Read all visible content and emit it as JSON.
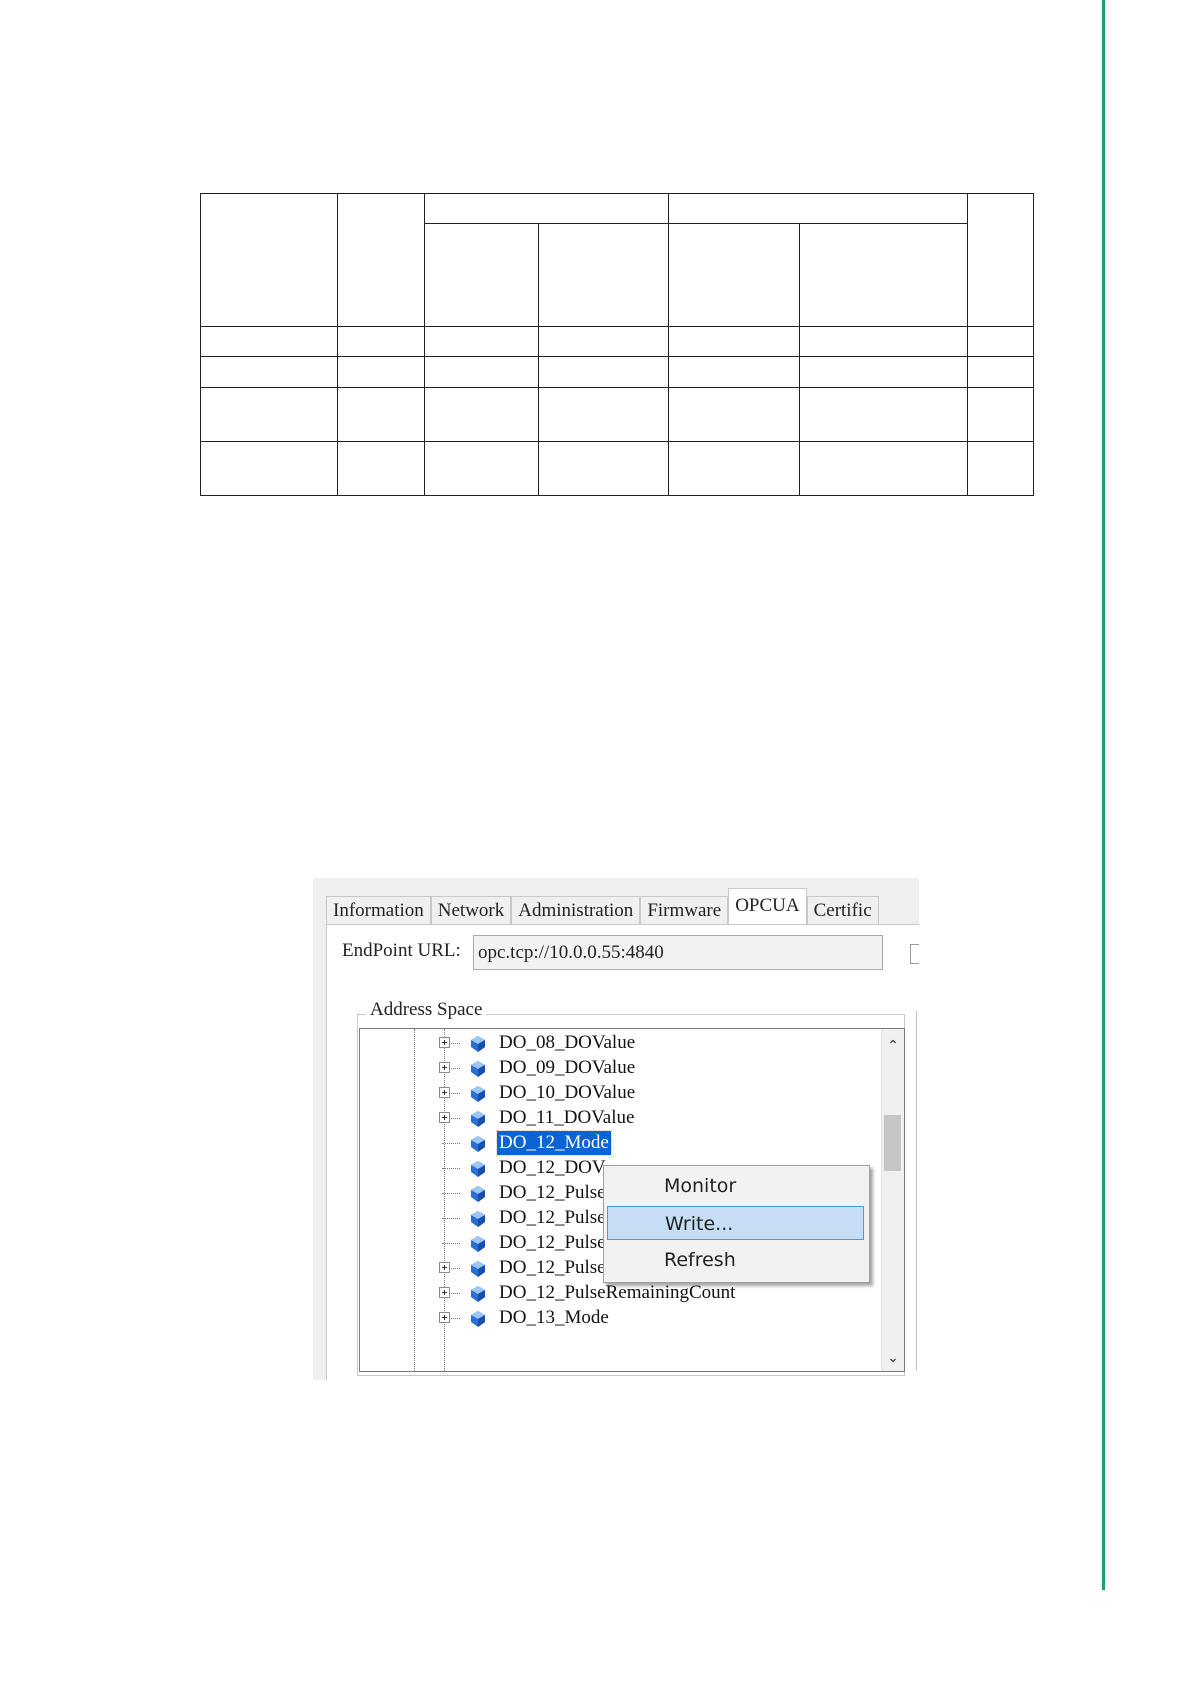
{
  "panel": {
    "tabs": [
      {
        "label": "Information"
      },
      {
        "label": "Network"
      },
      {
        "label": "Administration"
      },
      {
        "label": "Firmware"
      },
      {
        "label": "OPCUA"
      },
      {
        "label": "Certific"
      }
    ],
    "active_tab": "OPCUA",
    "endpoint_label": "EndPoint URL:",
    "endpoint_value": "opc.tcp://10.0.0.55:4840",
    "address_space_title": "Address Space",
    "tree_items": [
      {
        "label": "DO_08_DOValue"
      },
      {
        "label": "DO_09_DOValue"
      },
      {
        "label": "DO_10_DOValue"
      },
      {
        "label": "DO_11_DOValue"
      },
      {
        "label": "DO_12_Mode"
      },
      {
        "label": "DO_12_DOV"
      },
      {
        "label": "DO_12_Pulse"
      },
      {
        "label": "DO_12_Pulse"
      },
      {
        "label": "DO_12_Pulse"
      },
      {
        "label": "DO_12_PulseOutCount"
      },
      {
        "label": "DO_12_PulseRemainingCount"
      },
      {
        "label": "DO_13_Mode"
      }
    ],
    "selected_item": "DO_12_Mode",
    "context_menu": [
      {
        "label": "Monitor"
      },
      {
        "label": "Write..."
      },
      {
        "label": "Refresh"
      }
    ],
    "highlighted_menu_item": "Write..."
  },
  "colors": {
    "accent_rule": "#1e9e6a",
    "selection": "#0a64d2",
    "menu_highlight": "#c5def5"
  }
}
